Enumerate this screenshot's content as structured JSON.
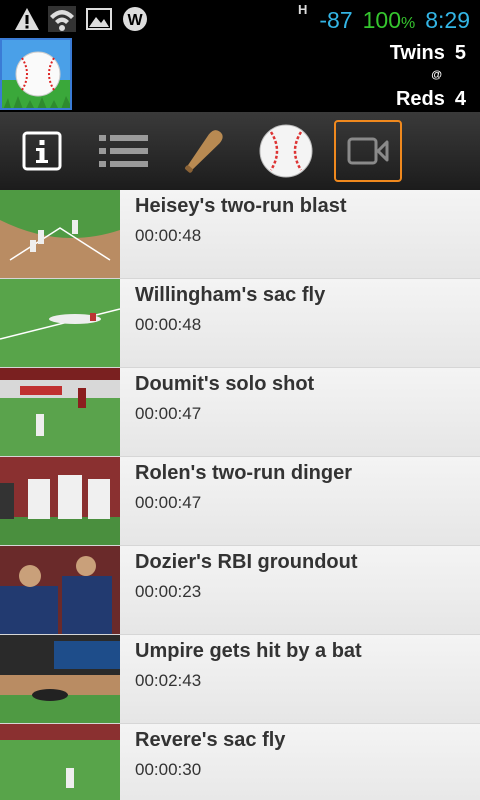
{
  "status_bar": {
    "icons": [
      "warning-icon",
      "wifi-icon",
      "gallery-icon",
      "w-app-icon"
    ],
    "network_type": "H",
    "signal": "-87",
    "battery": "100",
    "battery_unit": "%",
    "time": "8:29"
  },
  "game": {
    "away_team": "Twins",
    "away_score": "5",
    "at_symbol": "@",
    "home_team": "Reds",
    "home_score": "4"
  },
  "toolbar": {
    "tabs": [
      {
        "icon": "info-icon",
        "active": false
      },
      {
        "icon": "list-icon",
        "active": false
      },
      {
        "icon": "bat-icon",
        "active": false
      },
      {
        "icon": "baseball-icon",
        "active": false
      },
      {
        "icon": "video-camera-icon",
        "active": true
      }
    ]
  },
  "videos": [
    {
      "title": "Heisey's two-run blast",
      "duration": "00:00:48"
    },
    {
      "title": "Willingham's sac fly",
      "duration": "00:00:48"
    },
    {
      "title": "Doumit's solo shot",
      "duration": "00:00:47"
    },
    {
      "title": "Rolen's two-run dinger",
      "duration": "00:00:47"
    },
    {
      "title": "Dozier's RBI groundout",
      "duration": "00:00:23"
    },
    {
      "title": "Umpire gets hit by a bat",
      "duration": "00:02:43"
    },
    {
      "title": "Revere's sac fly",
      "duration": "00:00:30"
    }
  ],
  "colors": {
    "accent_blue": "#33b5e5",
    "battery_green": "#35c52e",
    "active_tab_orange": "#f0891e"
  }
}
